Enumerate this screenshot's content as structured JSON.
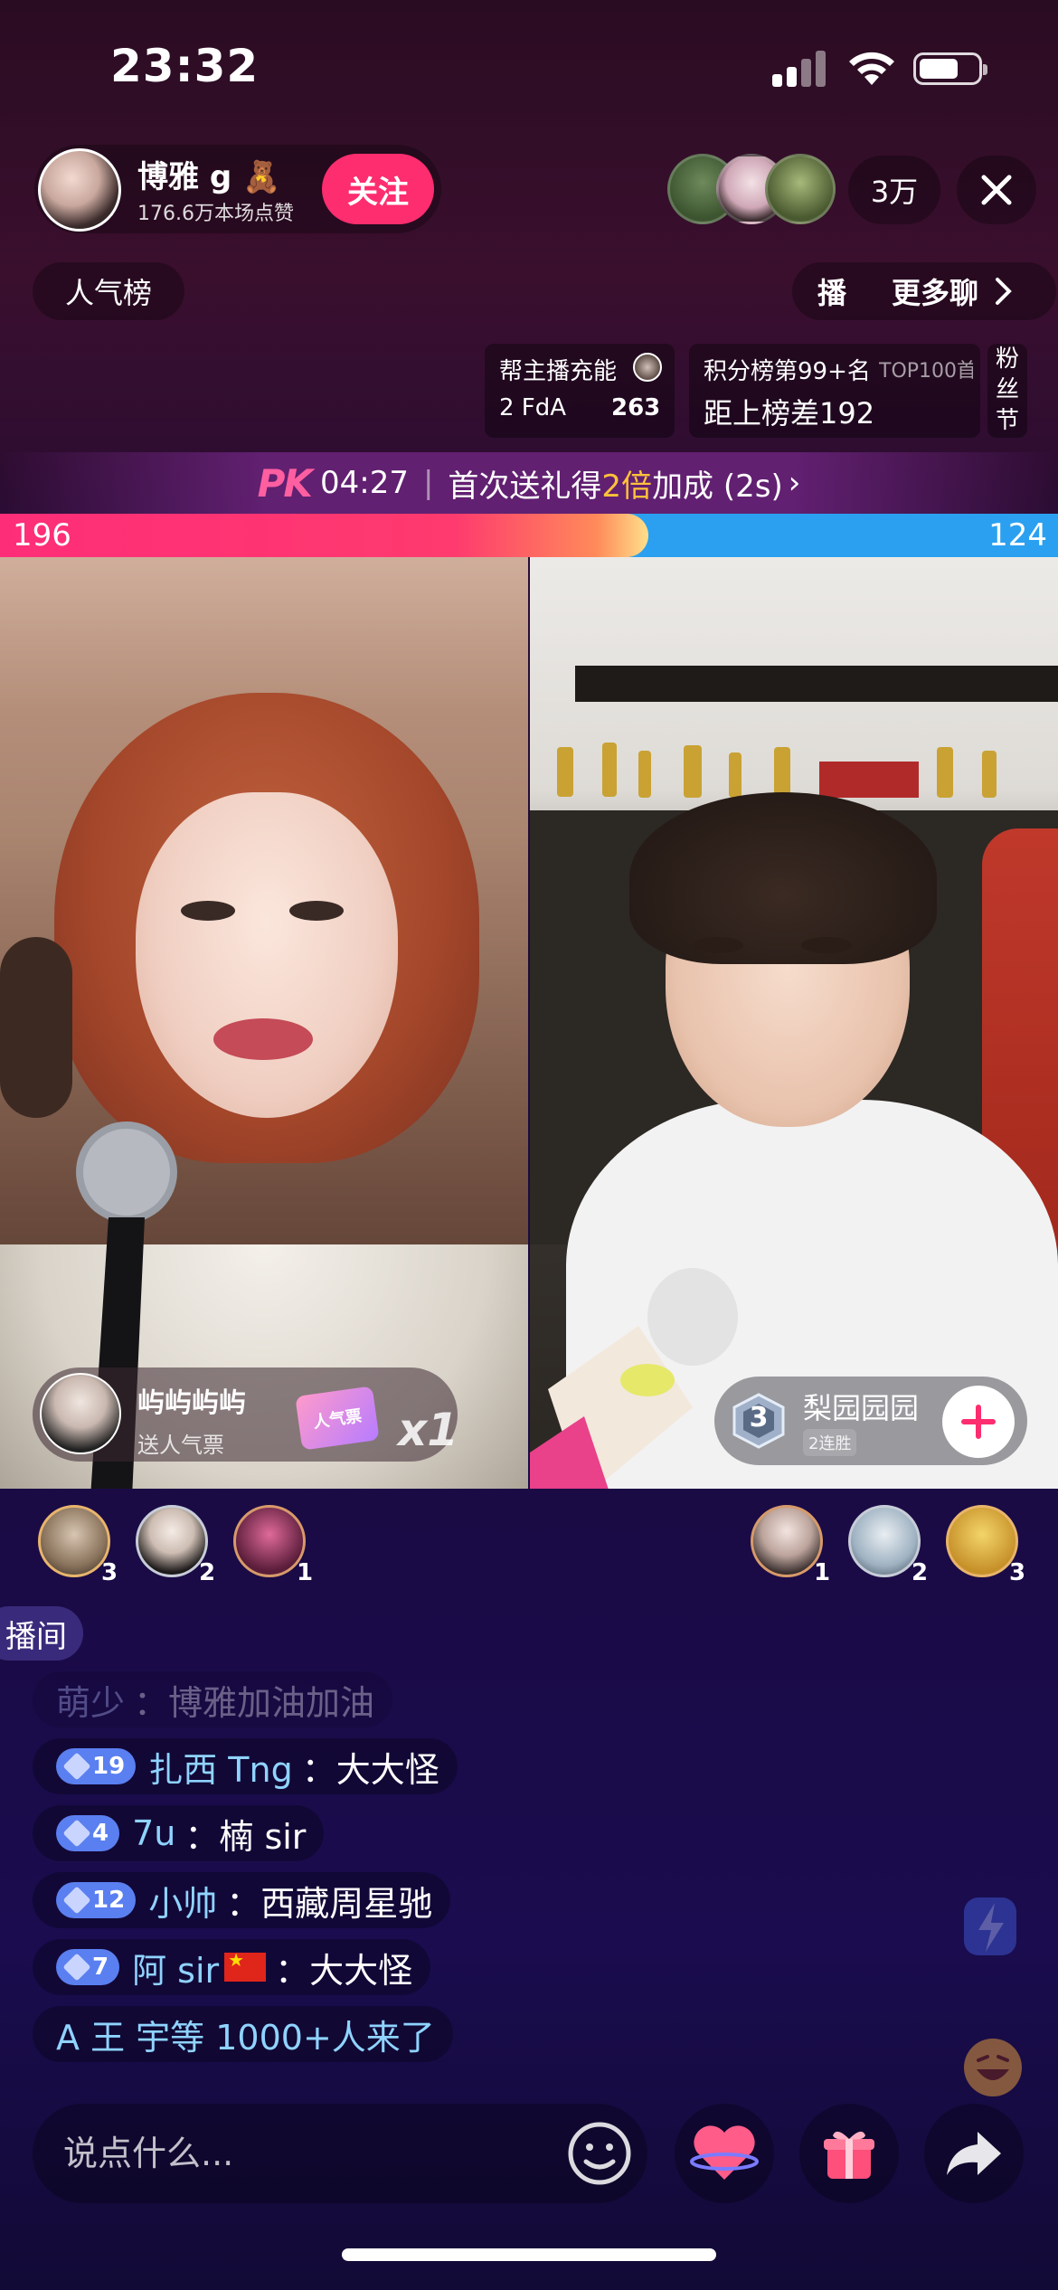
{
  "status_bar": {
    "time": "23:32"
  },
  "host": {
    "name": "博雅 g 🧸",
    "likes": "176.6万本场点赞",
    "follow_label": "关注"
  },
  "viewers": {
    "count": "3万"
  },
  "rank_label": "人气榜",
  "more": {
    "tab_label": "播",
    "chat_label": "更多聊"
  },
  "cards": {
    "charge_title": "帮主播充能",
    "charge_team": "2 FdA",
    "charge_value": "263",
    "score_title": "积分榜第99+名",
    "score_tag": "TOP100首",
    "score_gap": "距上榜差192",
    "fan_label": "粉丝节"
  },
  "pk": {
    "logo": "PK",
    "timer": "04:27",
    "promo_prefix": "首次送礼得",
    "promo_highlight": "2倍",
    "promo_suffix": "加成 (2s)",
    "chevron": "›",
    "score_left": "196",
    "score_right": "124",
    "left_share": 0.613
  },
  "gift_left": {
    "name": "屿屿屿屿",
    "action": "送人气票",
    "ticket_text": "人气票",
    "count": "x1"
  },
  "gift_right": {
    "name": "梨园园园",
    "streak": "2连胜",
    "badge": "3"
  },
  "contributors_left": [
    "3",
    "2",
    "1"
  ],
  "contributors_right": [
    "1",
    "2",
    "3"
  ],
  "room_tag": "播间",
  "chat": [
    {
      "user": "萌少",
      "sep": "：",
      "text": "博雅加油加油",
      "level": ""
    },
    {
      "user": "扎西 Tng",
      "sep": "：",
      "text": "大大怪",
      "level": "19"
    },
    {
      "user": "7u",
      "sep": "：",
      "text": "楠 sir",
      "level": "4"
    },
    {
      "user": "小帅",
      "sep": "：",
      "text": "西藏周星驰",
      "level": "12"
    },
    {
      "user": "阿 sir",
      "sep": "：",
      "text": "大大怪",
      "level": "7"
    }
  ],
  "join_message": "A 王 宇等 1000+人来了",
  "input": {
    "placeholder": "说点什么..."
  },
  "colors": {
    "accent_pink": "#fd2d6f",
    "score_blue": "#2ba0f0",
    "gold": "#ffc23a",
    "username_blue": "#8fd3ff"
  }
}
